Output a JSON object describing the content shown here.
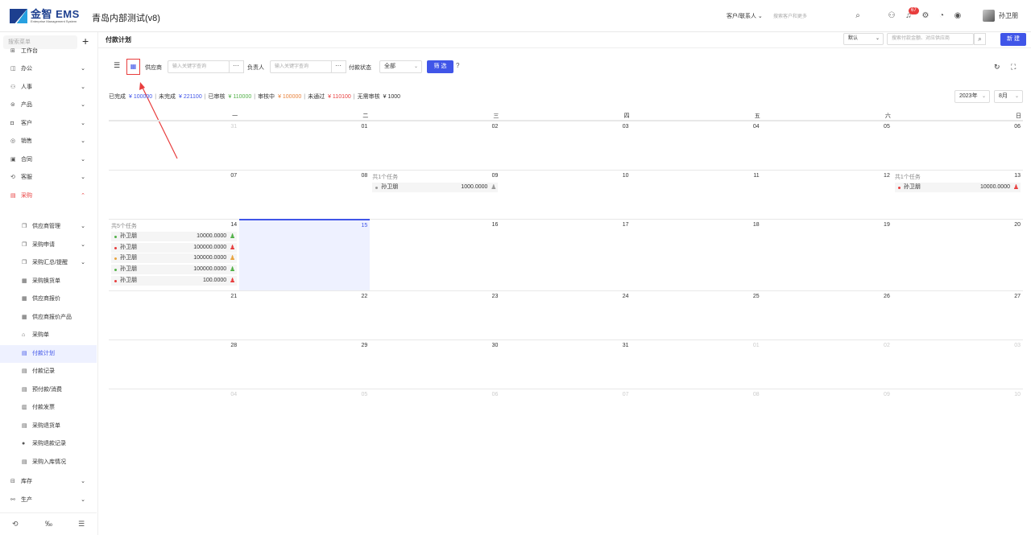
{
  "app": {
    "logo_text": "金智 EMS",
    "logo_sub": "Enterprise Management System",
    "title": "青岛内部测试(v8)"
  },
  "topbar": {
    "scope_select": "客户/联系人",
    "search_placeholder": "搜索客户和更多",
    "notif_count": "67",
    "username": "孙卫朋"
  },
  "sidebar": {
    "search_placeholder": "搜索菜单",
    "items": [
      {
        "label": "工作台",
        "icon": "⊞",
        "arrow": ""
      },
      {
        "label": "办公",
        "icon": "◫",
        "arrow": "⌄"
      },
      {
        "label": "人事",
        "icon": "⚇",
        "arrow": "⌄"
      },
      {
        "label": "产品",
        "icon": "⊜",
        "arrow": "⌄"
      },
      {
        "label": "客户",
        "icon": "◘",
        "arrow": "⌄"
      },
      {
        "label": "销售",
        "icon": "◎",
        "arrow": "⌄"
      },
      {
        "label": "合同",
        "icon": "▣",
        "arrow": "⌄"
      },
      {
        "label": "客服",
        "icon": "⟲",
        "arrow": "⌄"
      },
      {
        "label": "采购",
        "icon": "▤",
        "arrow": "⌃"
      }
    ],
    "subitems": [
      {
        "label": "供应商管理",
        "icon": "❐",
        "arrow": "⌄"
      },
      {
        "label": "采购申请",
        "icon": "❐",
        "arrow": "⌄"
      },
      {
        "label": "采购汇总/提醒",
        "icon": "❐",
        "arrow": "⌄"
      },
      {
        "label": "采购换货单",
        "icon": "▦",
        "arrow": ""
      },
      {
        "label": "供应商报价",
        "icon": "▦",
        "arrow": ""
      },
      {
        "label": "供应商报价产品",
        "icon": "▦",
        "arrow": ""
      },
      {
        "label": "采购单",
        "icon": "⌂",
        "arrow": ""
      },
      {
        "label": "付款计划",
        "icon": "▤",
        "arrow": ""
      },
      {
        "label": "付款记录",
        "icon": "▤",
        "arrow": ""
      },
      {
        "label": "预付款/消费",
        "icon": "▤",
        "arrow": ""
      },
      {
        "label": "付款发票",
        "icon": "▥",
        "arrow": ""
      },
      {
        "label": "采购退货单",
        "icon": "▤",
        "arrow": ""
      },
      {
        "label": "采购退款记录",
        "icon": "●",
        "arrow": ""
      },
      {
        "label": "采购入库情况",
        "icon": "▤",
        "arrow": ""
      }
    ],
    "after": [
      {
        "label": "库存",
        "icon": "⊟",
        "arrow": "⌄"
      },
      {
        "label": "生产",
        "icon": "⚯",
        "arrow": "⌄"
      }
    ]
  },
  "header": {
    "page_title": "付款计划",
    "view_select": "默认",
    "search_placeholder": "搜索付款金额、对应供应商",
    "new_label": "新 建"
  },
  "filters": {
    "supplier_label": "供应商",
    "supplier_placeholder": "输入关键字查询",
    "owner_label": "负责人",
    "owner_placeholder": "输入关键字查询",
    "status_label": "付款状态",
    "status_value": "全部",
    "filter_button": "筛 选"
  },
  "summary": [
    {
      "label": "已完成",
      "value": "¥ 100000",
      "color": "#4055e8"
    },
    {
      "label": "未完成",
      "value": "¥ 221100",
      "color": "#4055e8"
    },
    {
      "label": "已审核",
      "value": "¥ 110000",
      "color": "#52b148"
    },
    {
      "label": "审核中",
      "value": "¥ 100000",
      "color": "#e8833d"
    },
    {
      "label": "未通过",
      "value": "¥ 110100",
      "color": "#e83d3d"
    },
    {
      "label": "无需审核",
      "value": "¥ 1000",
      "color": "#333333"
    }
  ],
  "calendar": {
    "year": "2023年",
    "month": "8月",
    "weekdays": [
      "一",
      "二",
      "三",
      "四",
      "五",
      "六",
      "日"
    ],
    "weeks": [
      [
        {
          "d": "31",
          "out": true
        },
        {
          "d": "01"
        },
        {
          "d": "02"
        },
        {
          "d": "03"
        },
        {
          "d": "04"
        },
        {
          "d": "05"
        },
        {
          "d": "06"
        }
      ],
      [
        {
          "d": "07"
        },
        {
          "d": "08"
        },
        {
          "d": "09",
          "count": "共1个任务",
          "tasks": [
            {
              "name": "孙卫朋",
              "amount": "1000.0000",
              "color": "#999999"
            }
          ]
        },
        {
          "d": "10"
        },
        {
          "d": "11"
        },
        {
          "d": "12"
        },
        {
          "d": "13",
          "count": "共1个任务",
          "tasks": [
            {
              "name": "孙卫朋",
              "amount": "10000.0000",
              "color": "#e83d3d"
            }
          ]
        }
      ],
      [
        {
          "d": "14",
          "count": "共5个任务",
          "tasks": [
            {
              "name": "孙卫朋",
              "amount": "10000.0000",
              "color": "#52b148"
            },
            {
              "name": "孙卫朋",
              "amount": "100000.0000",
              "color": "#e83d3d"
            },
            {
              "name": "孙卫朋",
              "amount": "100000.0000",
              "color": "#e8a33d"
            },
            {
              "name": "孙卫朋",
              "amount": "100000.0000",
              "color": "#52b148"
            },
            {
              "name": "孙卫朋",
              "amount": "100.0000",
              "color": "#e83d3d"
            }
          ]
        },
        {
          "d": "15",
          "today": true
        },
        {
          "d": "16"
        },
        {
          "d": "17"
        },
        {
          "d": "18"
        },
        {
          "d": "19"
        },
        {
          "d": "20"
        }
      ],
      [
        {
          "d": "21"
        },
        {
          "d": "22"
        },
        {
          "d": "23"
        },
        {
          "d": "24"
        },
        {
          "d": "25"
        },
        {
          "d": "26"
        },
        {
          "d": "27"
        }
      ],
      [
        {
          "d": "28"
        },
        {
          "d": "29"
        },
        {
          "d": "30"
        },
        {
          "d": "31"
        },
        {
          "d": "01",
          "out": true
        },
        {
          "d": "02",
          "out": true
        },
        {
          "d": "03",
          "out": true
        }
      ],
      [
        {
          "d": "04",
          "out": true
        },
        {
          "d": "05",
          "out": true
        },
        {
          "d": "06",
          "out": true
        },
        {
          "d": "07",
          "out": true
        },
        {
          "d": "08",
          "out": true
        },
        {
          "d": "09",
          "out": true
        },
        {
          "d": "10",
          "out": true
        }
      ]
    ]
  }
}
